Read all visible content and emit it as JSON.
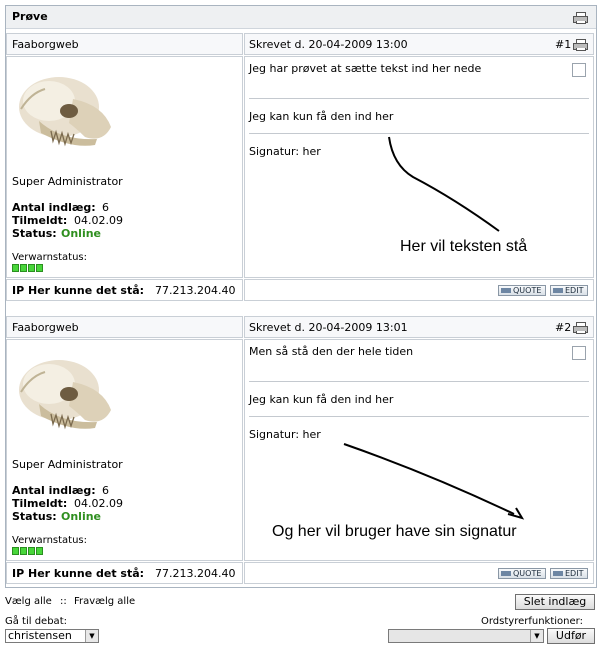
{
  "page": {
    "title": "Prøve",
    "posts": [
      {
        "author": "Faaborgweb",
        "rank": "Super Administrator",
        "posts_label": "Antal indlæg:",
        "posts_count": "6",
        "joined_label": "Tilmeldt:",
        "joined": "04.02.09",
        "status_label": "Status:",
        "status": "Online",
        "warn_label": "Verwarnstatus:",
        "written": "Skrevet d. 20-04-2009 13:00",
        "number": "#1",
        "body": "Jeg har prøvet at sætte tekst ind her nede",
        "body2": "Jeg kan kun få den ind her",
        "signature": "Signatur: her",
        "ip_label": "IP Her kunne det stå:",
        "ip": "77.213.204.40",
        "quote": "QUOTE",
        "edit": "EDIT",
        "annotation": "Her vil teksten stå"
      },
      {
        "author": "Faaborgweb",
        "rank": "Super Administrator",
        "posts_label": "Antal indlæg:",
        "posts_count": "6",
        "joined_label": "Tilmeldt:",
        "joined": "04.02.09",
        "status_label": "Status:",
        "status": "Online",
        "warn_label": "Verwarnstatus:",
        "written": "Skrevet d. 20-04-2009 13:01",
        "number": "#2",
        "body": "Men så stå den der hele tiden",
        "body2": "Jeg kan kun få den ind her",
        "signature": "Signatur: her",
        "ip_label": "IP Her kunne det stå:",
        "ip": "77.213.204.40",
        "quote": "QUOTE",
        "edit": "EDIT",
        "annotation": "Og her vil bruger have sin signatur"
      }
    ]
  },
  "footer": {
    "select_all": "Vælg alle",
    "separator": "::",
    "deselect_all": "Fravælg alle",
    "delete_button": "Slet indlæg",
    "goto_label": "Gå til debat:",
    "goto_value": "christensen",
    "mod_label": "Ordstyrerfunktioner:",
    "mod_value": "",
    "execute_button": "Udfør"
  },
  "colors": {
    "online": "#2f8f1f",
    "warn": "#48d63a"
  },
  "icons": [
    "printer-icon",
    "avatar-skull",
    "dropdown-arrow-icon"
  ]
}
